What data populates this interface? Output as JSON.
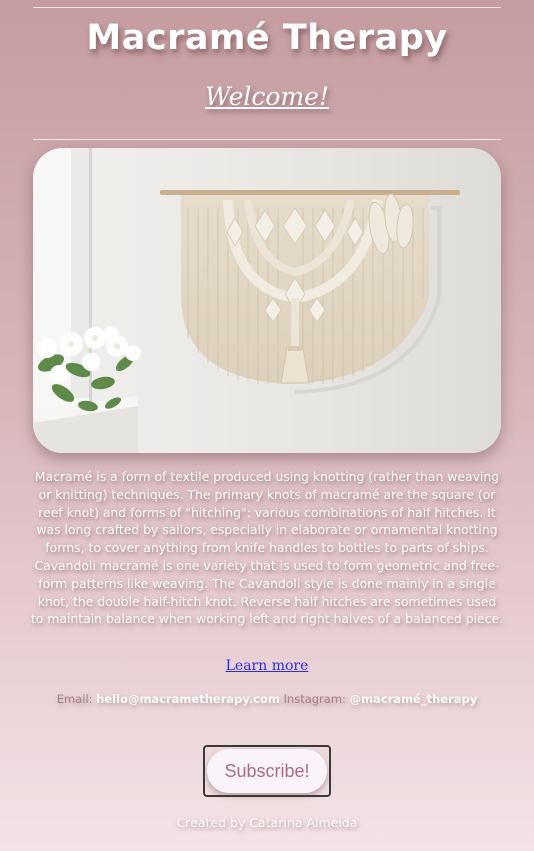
{
  "header": {
    "title": "Macramé Therapy",
    "subtitle": "Welcome!"
  },
  "hero": {
    "image_subject": "macrame-wall-hanging-photo"
  },
  "main": {
    "description": "Macramé is a form of textile produced using knotting (rather than weaving or knitting) techniques. The primary knots of macramé are the square (or reef knot) and forms of \"hitching\": various combinations of half hitches. It was long crafted by sailors, especially in elaborate or ornamental knotting forms, to cover anything from knife handles to bottles to parts of ships. Cavandoli macramé is one variety that is used to form geometric and free-form patterns like weaving. The Cavandoli style is done mainly in a single knot, the double half-hitch knot. Reverse half hitches are sometimes used to maintain balance when working left and right halves of a balanced piece.",
    "learn_more_label": "Learn more"
  },
  "contact": {
    "email_label": "Email:",
    "email_value": "hello@macrametherapy.com",
    "instagram_label": "Instagram:",
    "instagram_value": "@macramé_therapy"
  },
  "subscribe": {
    "label": "Subscribe!"
  },
  "footer": {
    "credit": "Created by Catarina Almeida"
  },
  "colors": {
    "gradient_top": "#c59da1",
    "gradient_bottom": "#f3e3e6",
    "link": "#2e2ee0",
    "button_text": "#b06b84"
  }
}
